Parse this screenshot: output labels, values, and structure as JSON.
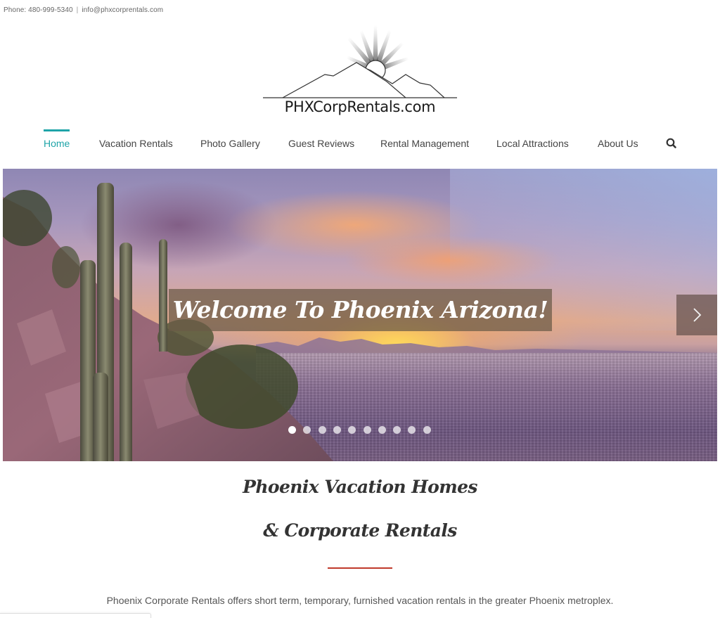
{
  "topbar": {
    "phone": "Phone: 480-999-5340",
    "separator": "|",
    "email": "info@phxcorprentals.com"
  },
  "logo": {
    "text": "PHXCorpRentals.com",
    "icon": "mountain-sunrise-logo"
  },
  "nav": {
    "items": [
      {
        "label": "Home",
        "active": true
      },
      {
        "label": "Vacation Rentals",
        "active": false
      },
      {
        "label": "Photo Gallery",
        "active": false
      },
      {
        "label": "Guest Reviews",
        "active": false
      },
      {
        "label": "Rental Management",
        "active": false
      },
      {
        "label": "Local Attractions",
        "active": false
      },
      {
        "label": "About Us",
        "active": false
      }
    ],
    "search_icon": "search-icon",
    "accent_color": "#1fa4a8"
  },
  "hero": {
    "caption": "Welcome To Phoenix Arizona!",
    "next_icon": "chevron-right-icon",
    "slide_count": 10,
    "active_slide": 1
  },
  "main": {
    "heading_line1": "Phoenix Vacation Homes",
    "heading_line2": "& Corporate Rentals",
    "divider_color": "#c0392b",
    "intro": "Phoenix Corporate Rentals offers short term, temporary, furnished vacation rentals in the greater Phoenix metroplex."
  }
}
